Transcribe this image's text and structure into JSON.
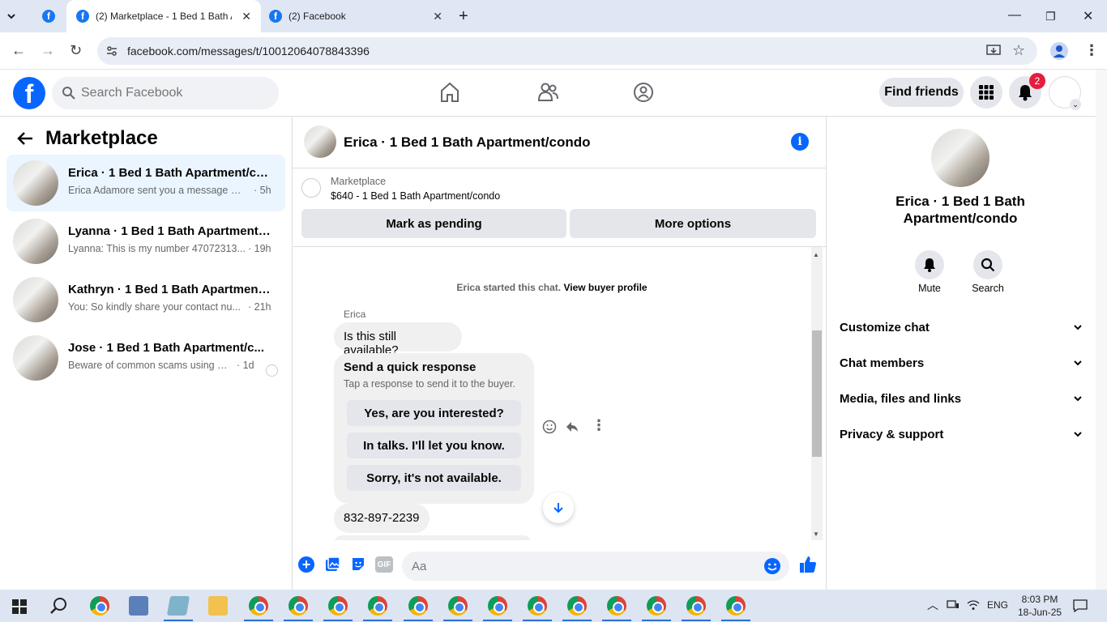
{
  "browser": {
    "tabs": [
      {
        "title": "(2) Marketplace - 1 Bed 1 Bath A",
        "active": true
      },
      {
        "title": "(2) Facebook",
        "active": false
      }
    ],
    "url": "facebook.com/messages/t/10012064078843396"
  },
  "fb_header": {
    "search_placeholder": "Search Facebook",
    "find_friends": "Find friends",
    "notification_count": "2"
  },
  "left_panel": {
    "title": "Marketplace",
    "conversations": [
      {
        "name": "Erica · 1 Bed 1 Bath Apartment/con...",
        "preview": "Erica Adamore sent you a message ab...",
        "time": "· 5h"
      },
      {
        "name": "Lyanna · 1 Bed 1 Bath Apartment/c...",
        "preview": "Lyanna: This is my number 47072313...",
        "time": "· 19h"
      },
      {
        "name": "Kathryn · 1 Bed 1 Bath Apartment/...",
        "preview": "You: So kindly share your contact nu...",
        "time": "· 21h"
      },
      {
        "name": "Jose · 1 Bed 1 Bath Apartment/c...",
        "preview": "Beware of common scams using p...",
        "time": "· 1d"
      }
    ]
  },
  "chat": {
    "title": "Erica · 1 Bed 1 Bath Apartment/condo",
    "marketplace_label": "Marketplace",
    "listing": "$640 - 1 Bed 1 Bath Apartment/condo",
    "mark_pending": "Mark as pending",
    "more_options": "More options",
    "started_text": "Erica started this chat.",
    "view_buyer_profile": "View buyer profile",
    "sender": "Erica",
    "message1": "Is this still available?",
    "quick_response_title": "Send a quick response",
    "quick_response_sub": "Tap a response to send it to the buyer.",
    "quick_options": [
      "Yes, are you interested?",
      "In talks. I'll let you know.",
      "Sorry, it's not available."
    ],
    "message2": "832-897-2239",
    "composer_placeholder": "Aa"
  },
  "right_panel": {
    "title_line1": "Erica · 1 Bed 1 Bath",
    "title_line2": "Apartment/condo",
    "mute": "Mute",
    "search": "Search",
    "sections": [
      "Customize chat",
      "Chat members",
      "Media, files and links",
      "Privacy & support"
    ]
  },
  "taskbar": {
    "lang": "ENG",
    "time": "8:03 PM",
    "date": "18-Jun-25"
  }
}
